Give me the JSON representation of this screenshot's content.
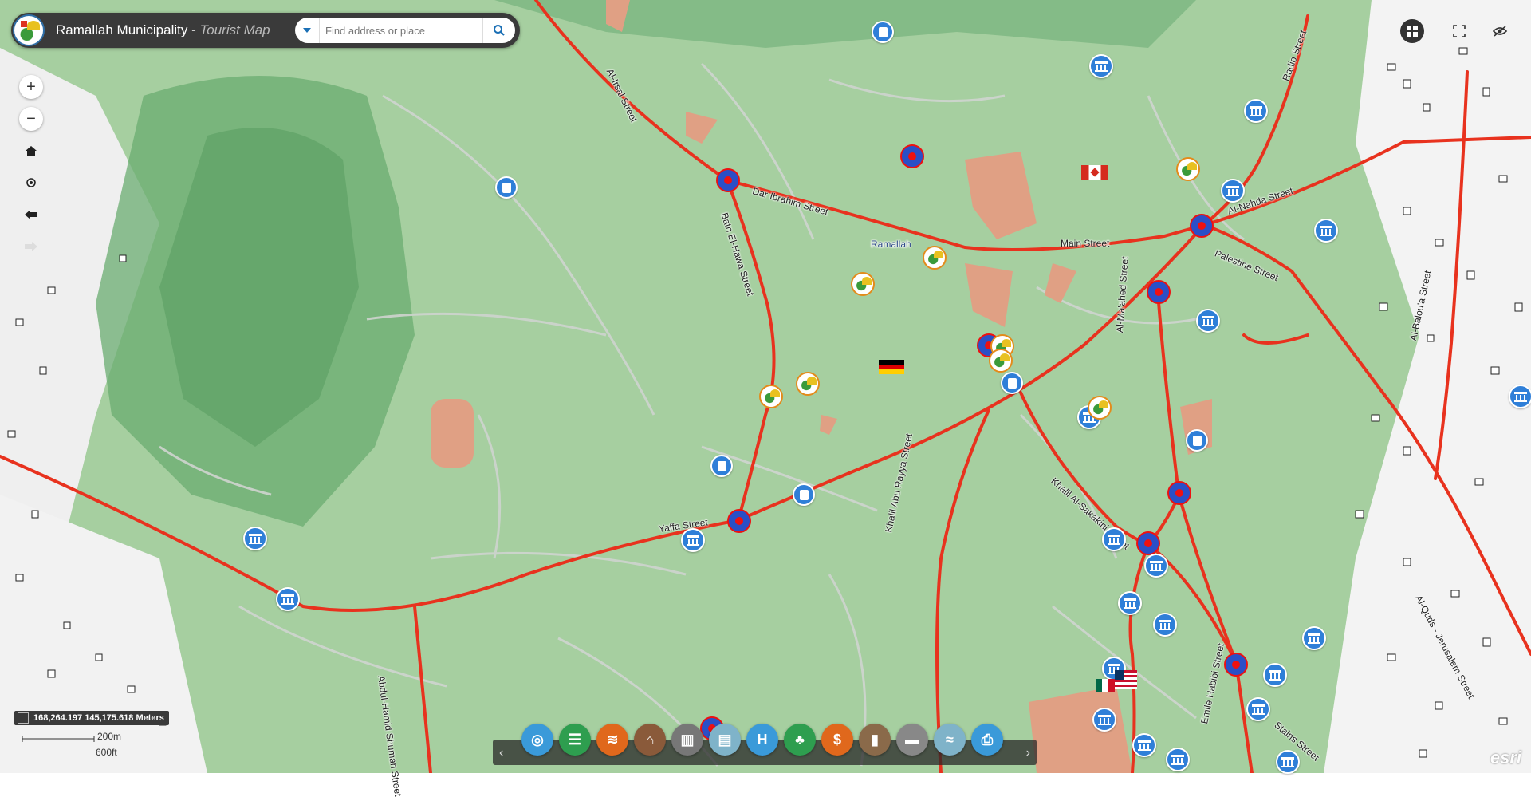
{
  "header": {
    "title": "Ramallah Municipality",
    "separator": " - ",
    "subtitle": "Tourist Map",
    "search_placeholder": "Find address or place"
  },
  "map": {
    "place_label": "Ramallah",
    "streets": [
      "Al-Irsal Street",
      "Dar Ibrahim Street",
      "Batn El-Hawa Street",
      "Main Street",
      "Al-Nahda Street",
      "Palestine Street",
      "Radio Street",
      "Al-Ma'ahed Street",
      "Yaffa Street",
      "Khalil Al-Sakakini Street",
      "Khalil Abu Rayya Street",
      "Abdul-Hamid Shuman Street",
      "Al-Balou'a Street",
      "Al-Quds - Jerusalem Street",
      "Emile Habibi Street",
      "Stains Street"
    ],
    "coordinates": "168,264.197 145,175.618 Meters",
    "scale_metric": "200m",
    "scale_imperial": "600ft",
    "attribution": "esri"
  },
  "widgets": [
    {
      "name": "basemap-gallery-button",
      "icon": "basemap-icon",
      "color": "#3a9ad9"
    },
    {
      "name": "legend-button",
      "icon": "list-icon",
      "color": "#2e9e4f"
    },
    {
      "name": "layers-button",
      "icon": "layers-icon",
      "color": "#e0681c"
    },
    {
      "name": "municipality-button",
      "icon": "municipality-icon",
      "color": "#8a5a3a"
    },
    {
      "name": "attractions-button",
      "icon": "attraction-icon",
      "color": "#777777"
    },
    {
      "name": "heritage-button",
      "icon": "heritage-icon",
      "color": "#7fb3c9"
    },
    {
      "name": "hospitals-button",
      "icon": "hospital-icon",
      "color": "#3a9ad9"
    },
    {
      "name": "parks-button",
      "icon": "park-icon",
      "color": "#2e9e4f"
    },
    {
      "name": "banks-button",
      "icon": "bank-icon",
      "color": "#e0681c"
    },
    {
      "name": "services-button",
      "icon": "service-icon",
      "color": "#8a6a4a"
    },
    {
      "name": "hotels-button",
      "icon": "hotel-icon",
      "color": "#888888"
    },
    {
      "name": "routes-button",
      "icon": "route-icon",
      "color": "#7fb3c9"
    },
    {
      "name": "print-button",
      "icon": "print-icon",
      "color": "#3a9ad9"
    }
  ],
  "colors": {
    "road": "#e8321e",
    "park": "#8fc28f",
    "hillshade": "#5fa86a",
    "header_bg": "#3a3a3a"
  }
}
